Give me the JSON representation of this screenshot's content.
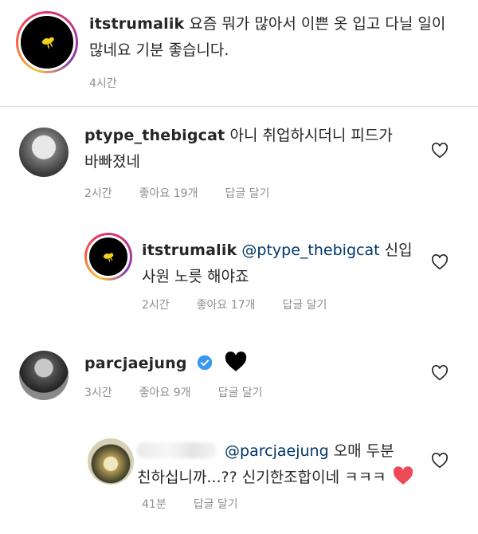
{
  "caption": {
    "username": "itstrumalik",
    "text_line1": "요즘 뭐가 많아서 이쁜 옷 입고 다닐 일이",
    "text_line2": "많네요 기분 좋습니다.",
    "time": "4시간"
  },
  "comments": [
    {
      "username": "ptype_thebigcat",
      "text_line1": "아니 취업하시더니 피드가",
      "text_line2": "바빠졌네",
      "time": "2시간",
      "likes": "좋아요 19개",
      "reply": "답글 달기"
    },
    {
      "username": "itstrumalik",
      "mention": "@ptype_thebigcat",
      "text_line1": "신입",
      "text_line2": "사원 노릇 해야죠",
      "time": "2시간",
      "likes": "좋아요 17개",
      "reply": "답글 달기"
    },
    {
      "username": "parcjaejung",
      "time": "3시간",
      "likes": "좋아요 9개",
      "reply": "답글 달기"
    },
    {
      "mention": "@parcjaejung",
      "text_line1": "오매 두분",
      "text_line2": "친하십니까...?? 신기한조합이네 ㅋㅋㅋ",
      "time": "41분",
      "reply": "답글 달기"
    }
  ],
  "colors": {
    "text": "#262626",
    "muted": "#8e8e8e",
    "mention": "#00376b",
    "verified": "#3897f0",
    "red_heart": "#ed4956"
  }
}
